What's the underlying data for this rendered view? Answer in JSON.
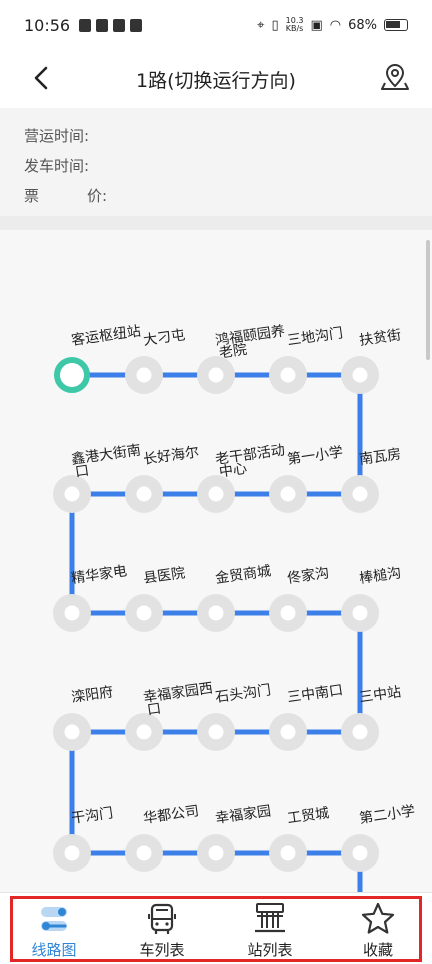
{
  "statusbar": {
    "time": "10:56",
    "net_speed_top": "10.3",
    "net_speed_bottom": "KB/s",
    "battery": "68%"
  },
  "header": {
    "title": "1路(切换运行方向)"
  },
  "info": {
    "service_hours_label": "营运时间:",
    "departure_label": "发车时间:",
    "fare_label_a": "票",
    "fare_label_b": "价:"
  },
  "route": {
    "stops": [
      "客运枢纽站",
      "大刁屯",
      "鸿福颐园养老院",
      "三地沟门",
      "扶贫街",
      "南瓦房",
      "第一小学",
      "老干部活动中心",
      "长好海尔",
      "鑫港大街南口",
      "精华家电",
      "县医院",
      "金贸商城",
      "佟家沟",
      "棒槌沟",
      "三中站",
      "三中南口",
      "石头沟门",
      "幸福家园西口",
      "滦阳府",
      "干沟门",
      "华都公司",
      "幸福家园",
      "工贸城",
      "第二小学"
    ],
    "colors": {
      "line": "#3d7fe8",
      "start": "#3ec8a8",
      "stop": "#e2e2e2"
    }
  },
  "tabs": [
    {
      "label": "线路图",
      "icon": "route-map-icon",
      "active": true
    },
    {
      "label": "车列表",
      "icon": "bus-icon",
      "active": false
    },
    {
      "label": "站列表",
      "icon": "station-list-icon",
      "active": false
    },
    {
      "label": "收藏",
      "icon": "star-icon",
      "active": false
    }
  ],
  "accent_color": "#2f86d6"
}
